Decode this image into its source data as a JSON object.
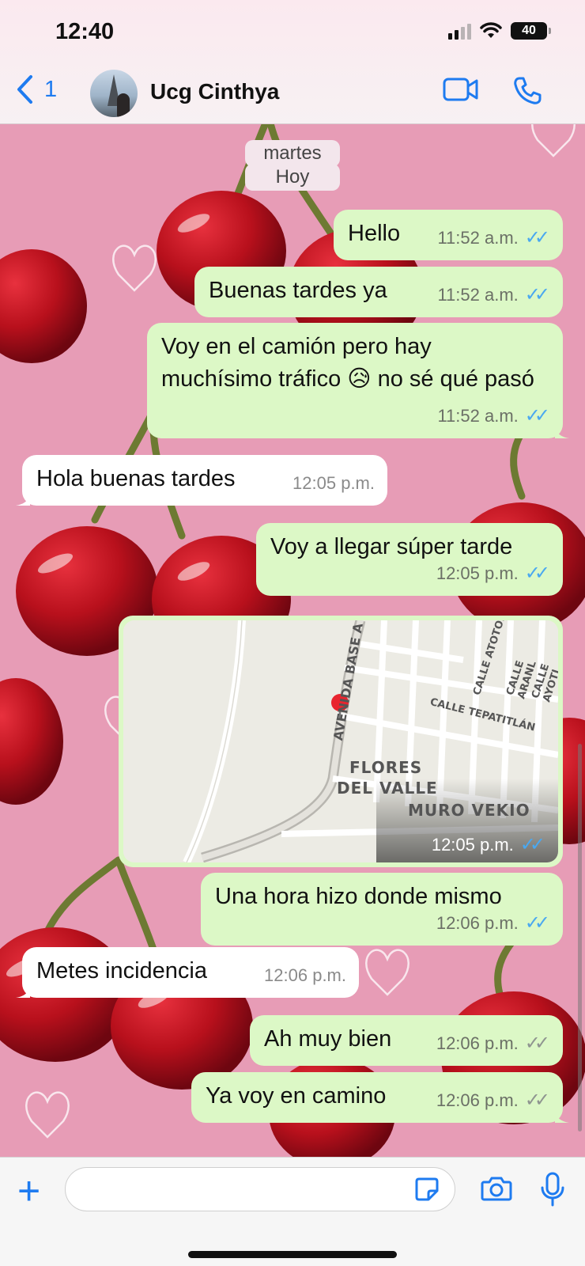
{
  "status": {
    "time": "12:40",
    "battery": "40"
  },
  "header": {
    "back_count": "1",
    "contact_name": "Ucg Cinthya",
    "avatar_icon": "avatar-eiffel-tower-icon",
    "video_icon": "video-call-icon",
    "phone_icon": "phone-call-icon"
  },
  "date_separators": [
    "martes",
    "Hoy"
  ],
  "messages": [
    {
      "direction": "out",
      "text": "Hello",
      "time": "11:52 a.m.",
      "status": "read"
    },
    {
      "direction": "out",
      "text": "Buenas tardes ya",
      "time": "11:52 a.m.",
      "status": "read"
    },
    {
      "direction": "out",
      "text": "Voy en el camión pero hay muchísimo tráfico 😥 no sé qué pasó",
      "time": "11:52 a.m.",
      "status": "read"
    },
    {
      "direction": "in",
      "text": "Hola buenas tardes",
      "time": "12:05 p.m."
    },
    {
      "direction": "out",
      "text": "Voy a llegar súper tarde",
      "time": "12:05 p.m.",
      "status": "read"
    },
    {
      "direction": "out",
      "type": "location",
      "time": "12:05 p.m.",
      "status": "read",
      "map_labels": [
        "AVENIDA BASE A",
        "CALLE ATOTON",
        "CALLE ARANL",
        "CALLE AYOTI",
        "CALLE TEPATITLÁN",
        "FLORES",
        "DEL VALLE",
        "MURO VEKIO"
      ]
    },
    {
      "direction": "out",
      "text": "Una hora hizo donde mismo",
      "time": "12:06 p.m.",
      "status": "read"
    },
    {
      "direction": "in",
      "text": "Metes incidencia",
      "time": "12:06 p.m."
    },
    {
      "direction": "out",
      "text": "Ah muy bien",
      "time": "12:06 p.m.",
      "status": "delivered"
    },
    {
      "direction": "out",
      "text": "Ya voy en camino",
      "time": "12:06 p.m.",
      "status": "delivered"
    }
  ],
  "colors": {
    "accent": "#1e7bf0",
    "outgoing_bubble": "#dcf8c6",
    "incoming_bubble": "#ffffff",
    "read_ticks": "#4aa8f0",
    "wallpaper": "#e79cb6",
    "cherry": "#b8101c"
  },
  "composer": {
    "value": "",
    "plus_icon": "plus-icon",
    "sticker_icon": "sticker-icon",
    "camera_icon": "camera-icon",
    "mic_icon": "microphone-icon"
  }
}
